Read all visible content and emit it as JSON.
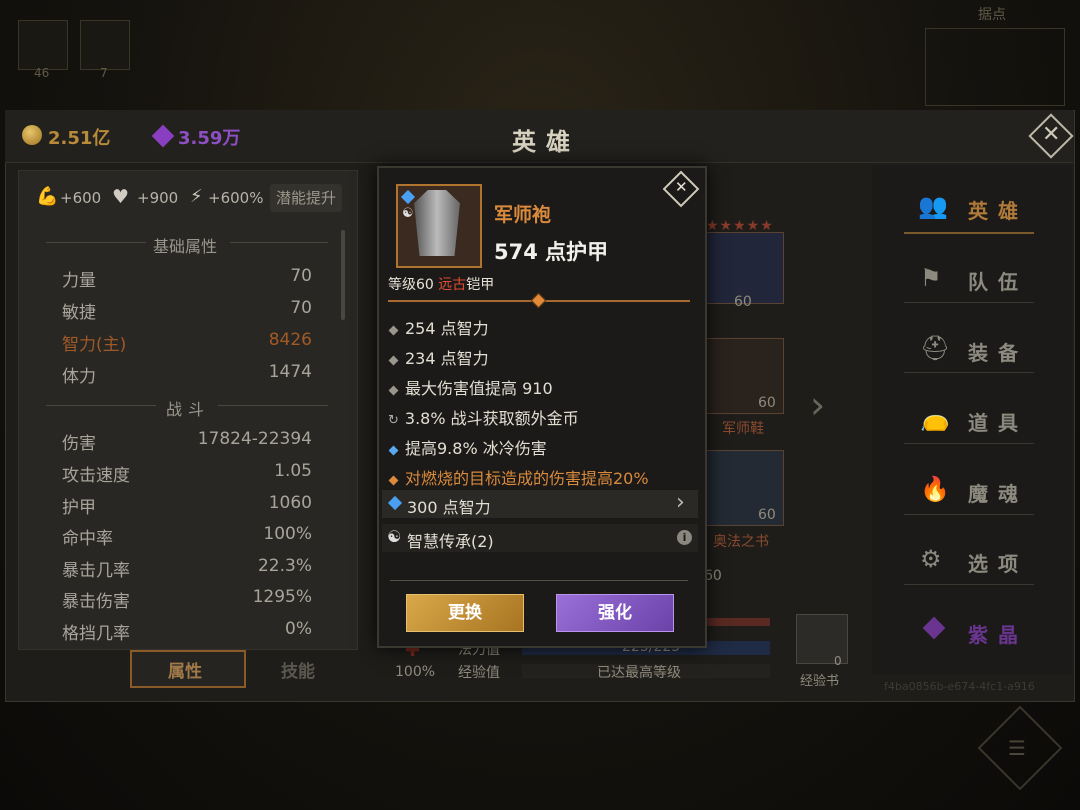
{
  "background": {
    "slot_counts": [
      "46",
      "7"
    ],
    "region_label": "据点"
  },
  "topbar": {
    "gold": "2.51亿",
    "crystals": "3.59万",
    "title": "英雄"
  },
  "left_panel": {
    "bonuses": [
      "+600",
      "+900",
      "+600%"
    ],
    "potential_button": "潜能提升",
    "basic_title": "基础属性",
    "basic_stats": [
      {
        "label": "力量",
        "value": "70"
      },
      {
        "label": "敏捷",
        "value": "70"
      },
      {
        "label": "智力(主)",
        "value": "8426"
      },
      {
        "label": "体力",
        "value": "1474"
      }
    ],
    "combat_title": "战斗",
    "combat_stats": [
      {
        "label": "伤害",
        "value": "17824-22394"
      },
      {
        "label": "攻击速度",
        "value": "1.05"
      },
      {
        "label": "护甲",
        "value": "1060"
      },
      {
        "label": "命中率",
        "value": "100%"
      },
      {
        "label": "暴击几率",
        "value": "22.3%"
      },
      {
        "label": "暴击伤害",
        "value": "1295%"
      },
      {
        "label": "格挡几率",
        "value": "0%"
      }
    ],
    "tabs": [
      "属性",
      "技能"
    ]
  },
  "middle": {
    "slot_levels": [
      "60",
      "60",
      "60"
    ],
    "slot_names": [
      "军师鞋",
      "奥法之书"
    ],
    "partial_num": "60",
    "percent": "100%",
    "mana_label": "法力值",
    "mana_value": "225/225",
    "xp_label": "经验值",
    "xp_value": "已达最高等级",
    "xp_book_label": "经验书",
    "xp_book_count": "0"
  },
  "right_nav": {
    "items": [
      "英雄",
      "队伍",
      "装备",
      "道具",
      "魔魂",
      "选项",
      "紫晶"
    ],
    "footer_id": "f4ba0856b-e674-4fc1-a916"
  },
  "popup": {
    "item_name": "军师袍",
    "armor": "574 点护甲",
    "level_prefix": "等级60",
    "rarity": "远古",
    "item_type": "铠甲",
    "stats": [
      "254 点智力",
      "234 点智力",
      "最大伤害值提高 910",
      "3.8% 战斗获取额外金币",
      "提高9.8% 冰冷伤害",
      "对燃烧的目标造成的伤害提高20%"
    ],
    "gem_stat": "300 点智力",
    "set_bonus": "智慧传承(2)",
    "replace_button": "更换",
    "enhance_button": "强化"
  },
  "colors": {
    "legendary_orange": "#d98a3c",
    "ancient_red": "#e04a32",
    "intellect_highlight": "#c96a2a",
    "replace_gold": "#c89532",
    "enhance_purple": "#8b5fc8"
  }
}
